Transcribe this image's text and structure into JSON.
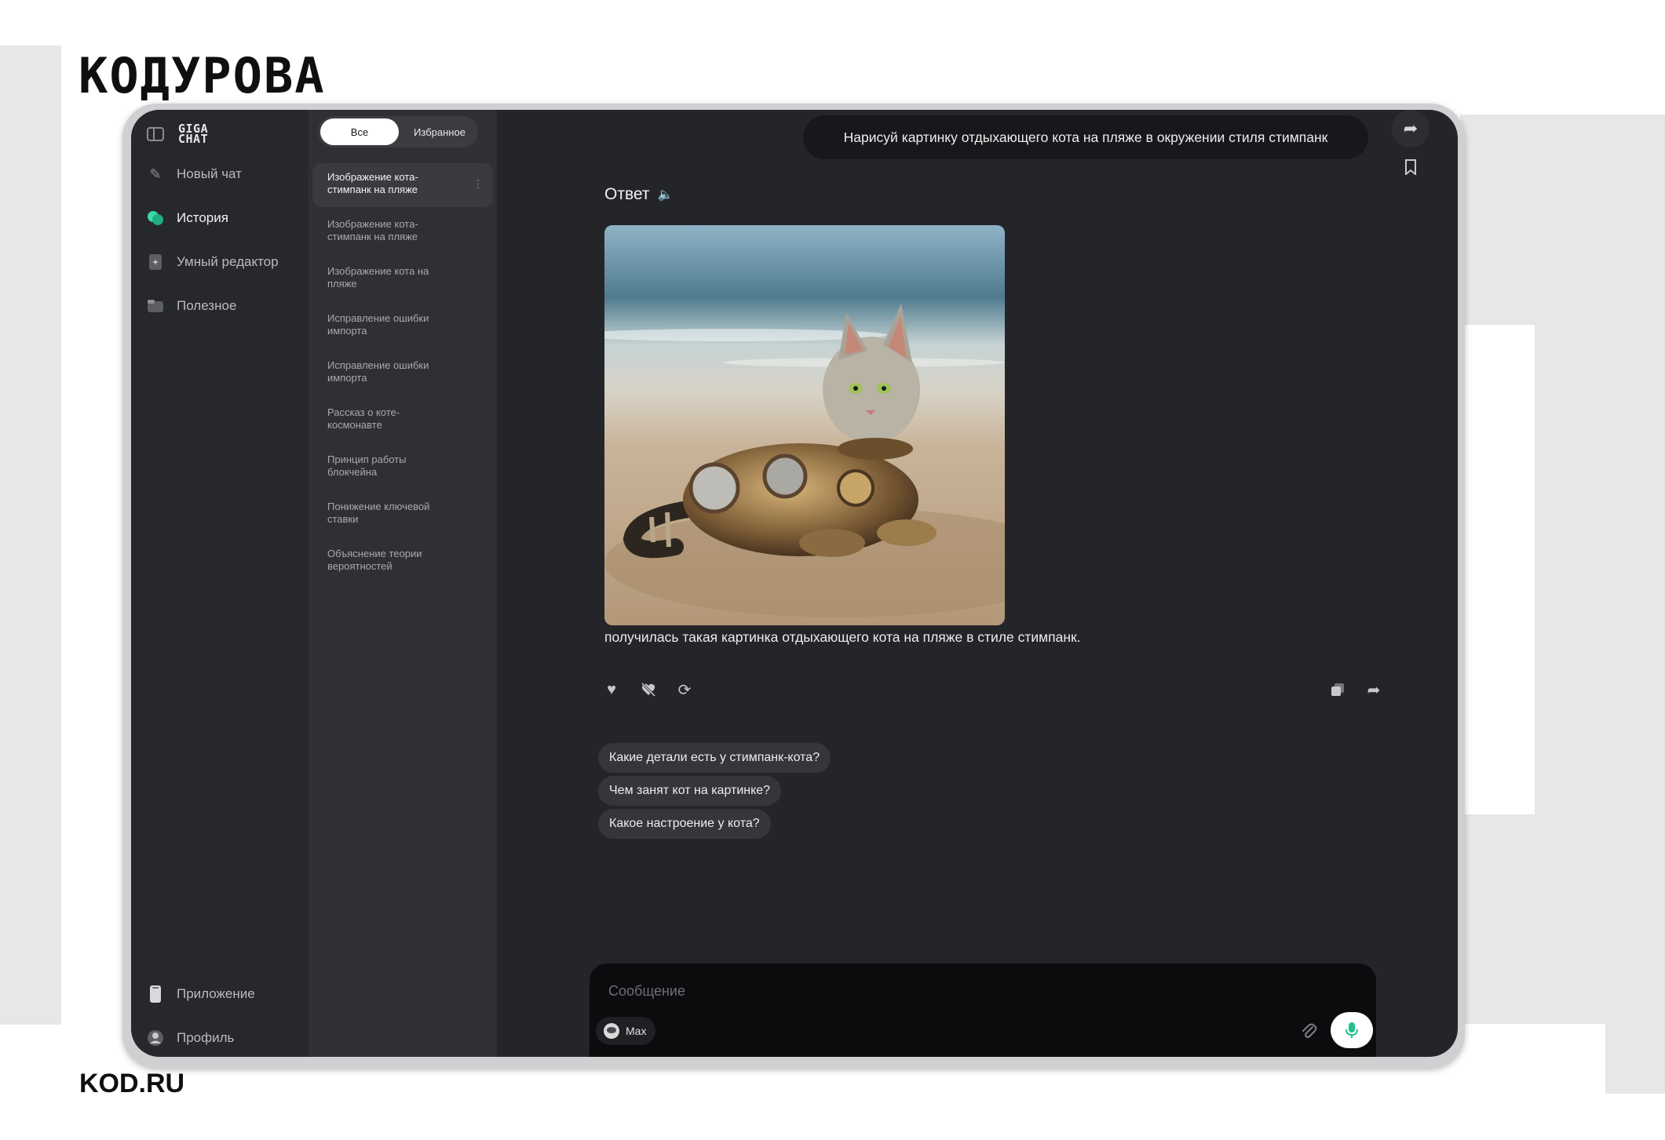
{
  "brand": {
    "logo": "КОДУРОВА",
    "site": "KOD.RU"
  },
  "app": {
    "logo_line1": "GIGA",
    "logo_line2": "CHAT"
  },
  "sidebar": {
    "items": [
      {
        "label": "Новый чат",
        "icon": "pencil-icon"
      },
      {
        "label": "История",
        "icon": "chat-bubbles-icon",
        "active": true
      },
      {
        "label": "Умный редактор",
        "icon": "document-sparkle-icon"
      },
      {
        "label": "Полезное",
        "icon": "folder-icon"
      }
    ],
    "bottom": [
      {
        "label": "Приложение",
        "icon": "phone-icon"
      },
      {
        "label": "Профиль",
        "icon": "user-icon"
      }
    ]
  },
  "history": {
    "tabs": {
      "all": "Все",
      "favorites": "Избранное",
      "selected": "all"
    },
    "items": [
      {
        "line1": "Изображение кота-",
        "line2": "стимпанк на пляже",
        "active": true
      },
      {
        "line1": "Изображение кота-",
        "line2": "стимпанк на пляже"
      },
      {
        "line1": "Изображение кота на",
        "line2": "пляже"
      },
      {
        "line1": "Исправление ошибки",
        "line2": "импорта"
      },
      {
        "line1": "Исправление ошибки",
        "line2": "импорта"
      },
      {
        "line1": "Рассказ о коте-",
        "line2": "космонавте"
      },
      {
        "line1": "Принцип работы",
        "line2": "блокчейна"
      },
      {
        "line1": "Понижение ключевой",
        "line2": "ставки"
      },
      {
        "line1": "Объяснение теории",
        "line2": "вероятностей"
      }
    ]
  },
  "chat": {
    "user_message": "Нарисуй картинку отдыхающего кота на пляже в окружении стиля стимпанк",
    "answer_title": "Ответ",
    "answer_text": "получилась такая картинка отдыхающего кота на пляже в стиле стимпанк.",
    "suggestions": [
      "Какие детали есть у стимпанк-кота?",
      "Чем занят кот на картинке?",
      "Какое настроение у кота?"
    ]
  },
  "composer": {
    "placeholder": "Сообщение",
    "value": "",
    "model": "Max"
  },
  "colors": {
    "accent": "#3ad8a6",
    "background": "#242529",
    "sidebar": "#27282c"
  }
}
